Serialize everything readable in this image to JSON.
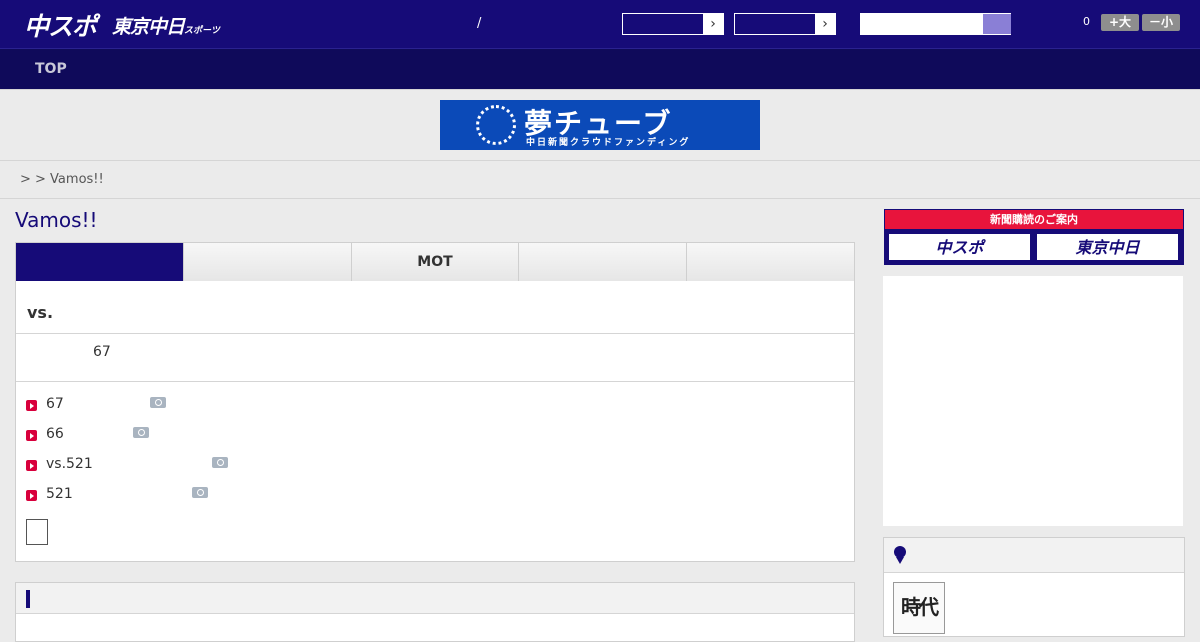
{
  "header": {
    "logo_chuspo": "中スポ",
    "logo_tokyo": "東京中日",
    "logo_tokyo_sub": "スポーツ",
    "separator": "/",
    "select_arrow_1": "›",
    "select_arrow_2": "›",
    "notification_count": "0",
    "font_larger": "+大",
    "font_smaller": "－小"
  },
  "nav": {
    "top": "TOP"
  },
  "banner": {
    "title": "夢チューブ",
    "subtitle": "中日新聞クラウドファンディング"
  },
  "breadcrumb": ">  > Vamos!!",
  "page": {
    "title": "Vamos!!"
  },
  "tabs": [
    {
      "label": ""
    },
    {
      "label": ""
    },
    {
      "label": "MOT"
    },
    {
      "label": ""
    },
    {
      "label": ""
    }
  ],
  "match": {
    "vs": "vs.",
    "score_line": "67"
  },
  "news": [
    {
      "text": "67"
    },
    {
      "text": "66"
    },
    {
      "text": "vs.521"
    },
    {
      "text": "521"
    }
  ],
  "sidebar": {
    "subscription_header": "新聞購読のご案内",
    "sub_chuspo": "中スポ",
    "sub_tokyo": "東京中日",
    "ranking_thumb_text": "時代"
  },
  "colors": {
    "brand_navy": "#160b78",
    "nav_dark": "#0f0a5a",
    "accent_red": "#e8143c",
    "banner_blue": "#0b4ab8"
  }
}
